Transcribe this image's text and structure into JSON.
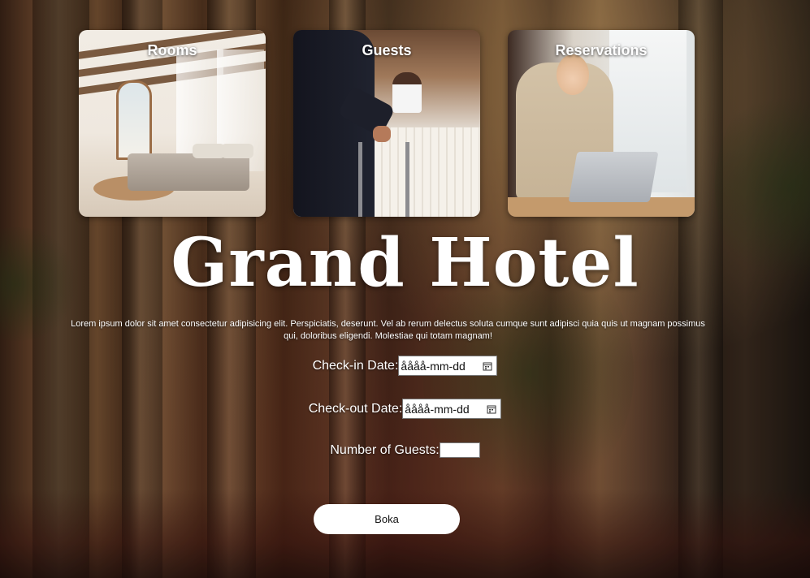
{
  "cards": [
    {
      "label": "Rooms"
    },
    {
      "label": "Guests"
    },
    {
      "label": "Reservations"
    }
  ],
  "hero": {
    "title": "Grand Hotel",
    "description": "Lorem ipsum dolor sit amet consectetur adipisicing elit. Perspiciatis, deserunt. Vel ab rerum delectus soluta cumque sunt adipisci quia quis ut magnam possimus qui, doloribus eligendi. Molestiae qui totam magnam!"
  },
  "form": {
    "checkin_label": "Check-in Date:",
    "checkin_placeholder": "åååå-mm-dd",
    "checkout_label": "Check-out Date:",
    "checkout_placeholder": "åååå-mm-dd",
    "guests_label": "Number of Guests:",
    "guests_value": "",
    "submit_label": "Boka"
  },
  "icons": {
    "date_picker": "calendar-icon"
  }
}
